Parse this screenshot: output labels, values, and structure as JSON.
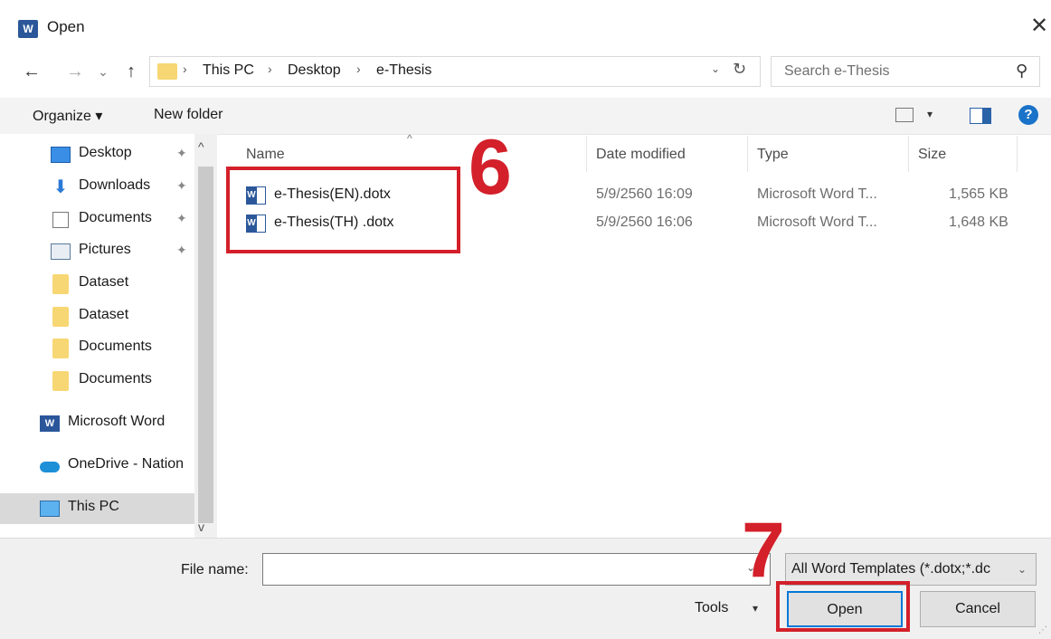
{
  "window": {
    "title": "Open",
    "app_icon": "word-icon",
    "close_glyph": "✕"
  },
  "nav": {
    "back": "←",
    "forward": "→",
    "recent": "⌄",
    "up": "↑",
    "breadcrumb": [
      "This PC",
      "Desktop",
      "e-Thesis"
    ],
    "separator": "›",
    "dropdown": "⌄",
    "refresh": "↻",
    "search_placeholder": "Search e-Thesis",
    "search_icon": "⚲"
  },
  "toolbar": {
    "organize": "Organize ▾",
    "new_folder": "New folder",
    "view_dd": "▾",
    "help": "?"
  },
  "sidebar": {
    "items": [
      {
        "label": "Desktop",
        "icon": "desktop-icon",
        "pinned": true
      },
      {
        "label": "Downloads",
        "icon": "download-icon",
        "pinned": true
      },
      {
        "label": "Documents",
        "icon": "documents-icon",
        "pinned": true
      },
      {
        "label": "Pictures",
        "icon": "pictures-icon",
        "pinned": true
      },
      {
        "label": "Dataset",
        "icon": "folder-icon",
        "pinned": false
      },
      {
        "label": "Dataset",
        "icon": "folder-icon",
        "pinned": false
      },
      {
        "label": "Documents",
        "icon": "folder-icon",
        "pinned": false
      },
      {
        "label": "Documents",
        "icon": "folder-icon",
        "pinned": false
      },
      {
        "label": "Microsoft Word",
        "icon": "word-icon",
        "pinned": false
      },
      {
        "label": "OneDrive - Nation",
        "icon": "onedrive-icon",
        "pinned": false
      },
      {
        "label": "This PC",
        "icon": "pc-icon",
        "pinned": false,
        "selected": true
      }
    ],
    "pin_glyph": "✦",
    "scroll_up": "^",
    "scroll_down": "v"
  },
  "filelist": {
    "columns": [
      "Name",
      "Date modified",
      "Type",
      "Size"
    ],
    "sort_glyph": "^",
    "rows": [
      {
        "name": "e-Thesis(EN).dotx",
        "date": "5/9/2560 16:09",
        "type": "Microsoft Word T...",
        "size": "1,565 KB"
      },
      {
        "name": "e-Thesis(TH) .dotx",
        "date": "5/9/2560 16:06",
        "type": "Microsoft Word T...",
        "size": "1,648 KB"
      }
    ]
  },
  "annotations": {
    "step6": "6",
    "step7": "7",
    "color": "#d3202a"
  },
  "footer": {
    "file_name_label": "File name:",
    "file_name_value": "",
    "file_type": "All Word Templates (*.dotx;*.dc",
    "tools": "Tools",
    "open": "Open",
    "cancel": "Cancel"
  },
  "colors": {
    "accent": "#0078d7",
    "selected_bg": "#d9d9d9",
    "word_blue": "#2b579a"
  }
}
